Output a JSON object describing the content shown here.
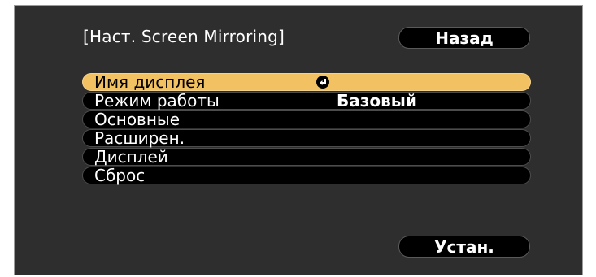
{
  "dialog": {
    "title": "[Наст. Screen Mirroring]",
    "back_button": "Назад",
    "set_button": "Устан."
  },
  "menu": {
    "items": [
      {
        "label": "Имя дисплея",
        "value": "",
        "selected": true,
        "icon": "enter-icon"
      },
      {
        "label": "Режим работы",
        "value": "Базовый"
      },
      {
        "label": "Основные",
        "value": ""
      },
      {
        "label": "Расширен.",
        "value": ""
      },
      {
        "label": "Дисплей",
        "value": ""
      },
      {
        "label": "Сброс",
        "value": ""
      }
    ]
  },
  "colors": {
    "panel_bg": "#2e2e2e",
    "selected_bg": "#f2c161",
    "item_bg": "#000000",
    "text": "#ffffff"
  }
}
